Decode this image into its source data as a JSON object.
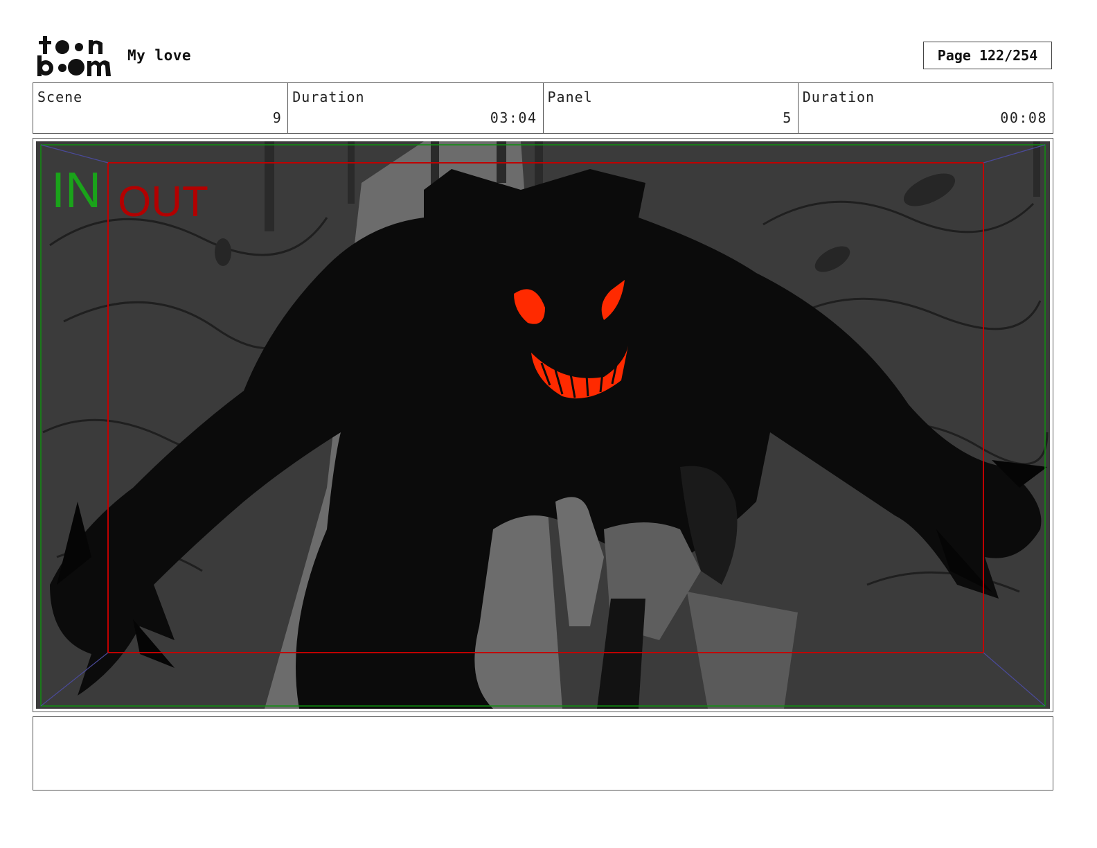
{
  "header": {
    "logo_top": "toon",
    "logo_bottom": "boom",
    "project_title": "My love",
    "page_label": "Page 122/254"
  },
  "info": {
    "scene_label": "Scene",
    "scene_value": "9",
    "scene_duration_label": "Duration",
    "scene_duration_value": "03:04",
    "panel_label": "Panel",
    "panel_value": "5",
    "panel_duration_label": "Duration",
    "panel_duration_value": "00:08"
  },
  "panel": {
    "in_label": "IN",
    "out_label": "OUT",
    "in_color": "#1aa31a",
    "out_color": "#b30000",
    "eye_color": "#ff2a00"
  },
  "notes": {
    "text": ""
  }
}
